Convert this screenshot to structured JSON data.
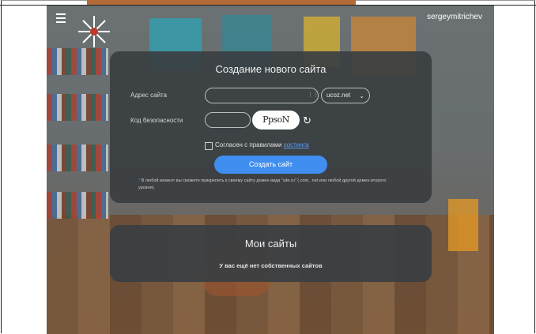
{
  "header": {
    "username": "sergeymitrichev"
  },
  "create_site": {
    "title": "Создание нового сайта",
    "address_label": "Адрес сайта",
    "address_value": "",
    "domain_selected": "ucoz.net",
    "security_label": "Код безопасности",
    "security_value": "",
    "captcha_text": "PpsoN",
    "agree_prefix": "Согласен с правилами ",
    "agree_link": "хостинга",
    "submit_label": "Создать сайт",
    "footnote": "В любой момент вы сможете прикрепить к своему сайту домен вида \"site.ru\" (.com, .net или любой другой домен второго уровня)."
  },
  "my_sites": {
    "title": "Мои сайты",
    "empty_text": "У вас ещё нет собственных сайтов"
  },
  "icons": {
    "menu": "hamburger-menu-icon",
    "refresh": "refresh-icon",
    "select_chevron": "chevron-down-icon",
    "field_icon": "grid-icon"
  },
  "colors": {
    "accent": "#3f8ef0",
    "link": "#5b9cf2",
    "panel": "#3a3e42"
  }
}
